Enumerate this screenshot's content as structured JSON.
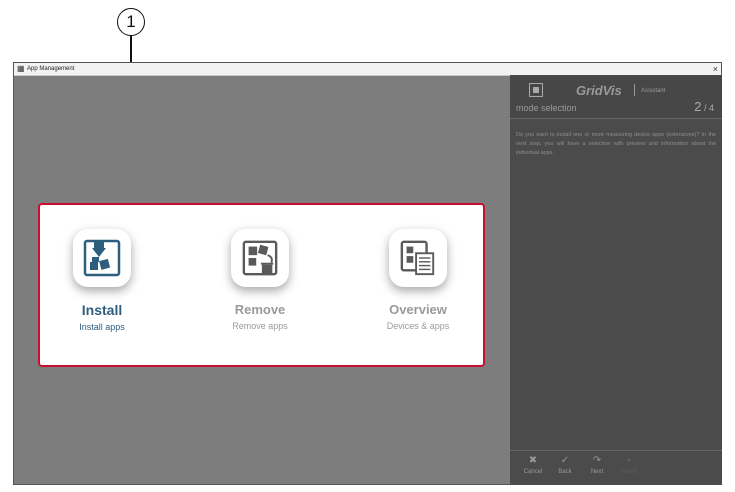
{
  "callout": {
    "number": "1"
  },
  "window": {
    "title": "App Management",
    "close": "×"
  },
  "panel": {
    "brand": "GridVis",
    "brand_suffix": "Assistant",
    "mode_label": "mode selection",
    "step_current": "2",
    "step_total": "4",
    "description": "Do you want to install one or more measuring device apps (extensions)? In the next step, you will have a selection with preview and information about the individual apps."
  },
  "options": [
    {
      "title": "Install",
      "subtitle": "Install apps",
      "icon": "install-icon",
      "active": true
    },
    {
      "title": "Remove",
      "subtitle": "Remove apps",
      "icon": "remove-icon",
      "active": false
    },
    {
      "title": "Overview",
      "subtitle": "Devices & apps",
      "icon": "overview-icon",
      "active": false
    }
  ],
  "footer": {
    "cancel": "Cancel",
    "back": "Back",
    "next": "Next",
    "finish": "Finish"
  },
  "colors": {
    "accent": "#2d5e7e",
    "highlight_border": "#c8102e",
    "background": "#7d7d7d",
    "panel": "#4b4b4b"
  }
}
